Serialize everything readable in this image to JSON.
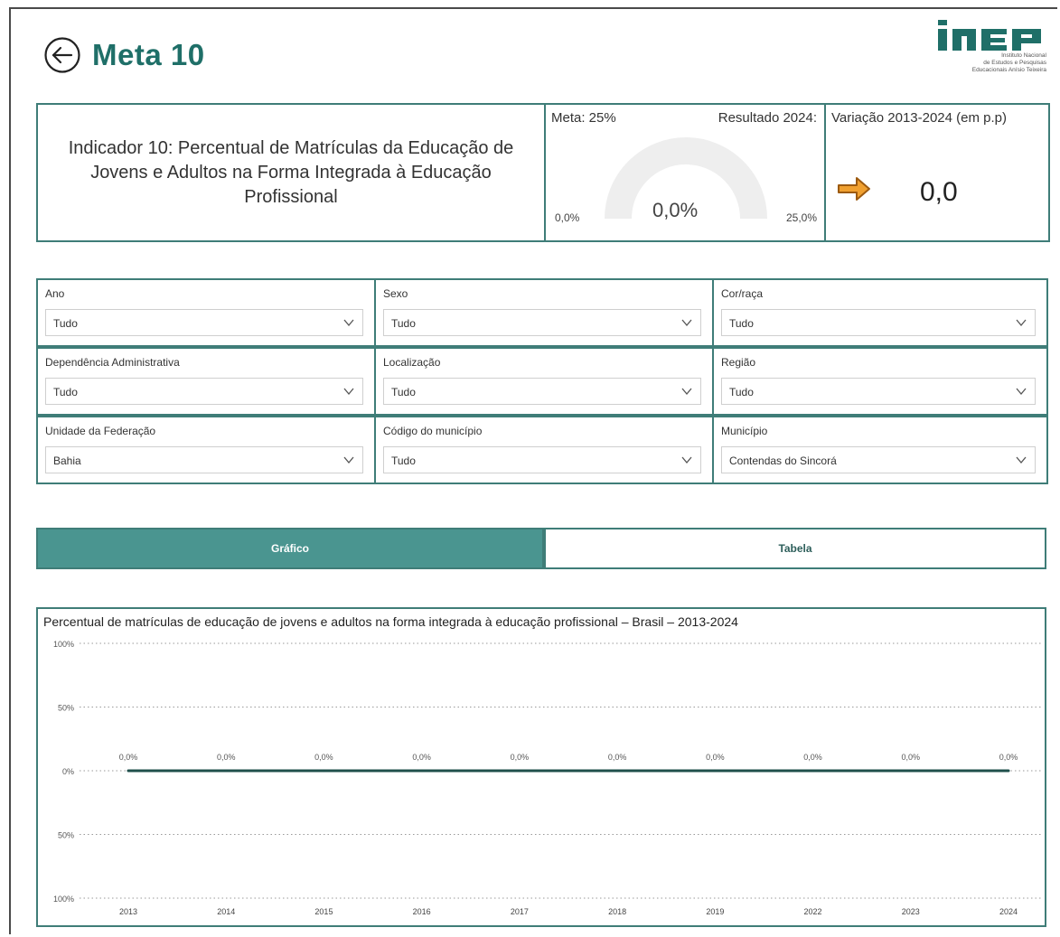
{
  "header": {
    "title": "Meta 10"
  },
  "logo": {
    "brand": "inep",
    "caption_lines": [
      "Instituto Nacional",
      "de Estudos e Pesquisas",
      "Educacionais Anísio Teixeira"
    ]
  },
  "indicator": {
    "text": "Indicador 10: Percentual de Matrículas da Educação de Jovens e Adultos na Forma Integrada à Educação Profissional"
  },
  "gauge": {
    "meta_label": "Meta: 25%",
    "result_label": "Resultado 2024:",
    "min_label": "0,0%",
    "max_label": "25,0%",
    "value_label": "0,0%",
    "value_fraction": 0
  },
  "variation": {
    "title": "Variação 2013-2024 (em p.p)",
    "value": "0,0",
    "arrow_icon": "arrow-right-icon",
    "arrow_color": "#d08a1e"
  },
  "filters": [
    {
      "label": "Ano",
      "value": "Tudo"
    },
    {
      "label": "Sexo",
      "value": "Tudo"
    },
    {
      "label": "Cor/raça",
      "value": "Tudo"
    },
    {
      "label": "Dependência Administrativa",
      "value": "Tudo"
    },
    {
      "label": "Localização",
      "value": "Tudo"
    },
    {
      "label": "Região",
      "value": "Tudo"
    },
    {
      "label": "Unidade da Federação",
      "value": "Bahia"
    },
    {
      "label": "Código do município",
      "value": "Tudo"
    },
    {
      "label": "Município",
      "value": "Contendas do Sincorá"
    }
  ],
  "tabs": {
    "grafico": "Gráfico",
    "tabela": "Tabela"
  },
  "colors": {
    "accent": "#1f6f68",
    "border": "#3f7d78",
    "tab_active": "#4a9590"
  },
  "chart_data": {
    "type": "line",
    "title": "Percentual de matrículas de educação de jovens e adultos na forma integrada à educação profissional – Brasil – 2013-2024",
    "categories": [
      "2013",
      "2014",
      "2015",
      "2016",
      "2017",
      "2018",
      "2019",
      "2022",
      "2023",
      "2024"
    ],
    "series": [
      {
        "values": [
          0,
          0,
          0,
          0,
          0,
          0,
          0,
          0,
          0,
          0
        ],
        "labels": [
          "0,0%",
          "0,0%",
          "0,0%",
          "0,0%",
          "0,0%",
          "0,0%",
          "0,0%",
          "0,0%",
          "0,0%",
          "0,0%"
        ]
      }
    ],
    "yticks": [
      "100%",
      "50%",
      "0%",
      "50%",
      "100%"
    ],
    "ylim": [
      -100,
      100
    ],
    "grid": true,
    "line_color": "#1f4f4b"
  }
}
